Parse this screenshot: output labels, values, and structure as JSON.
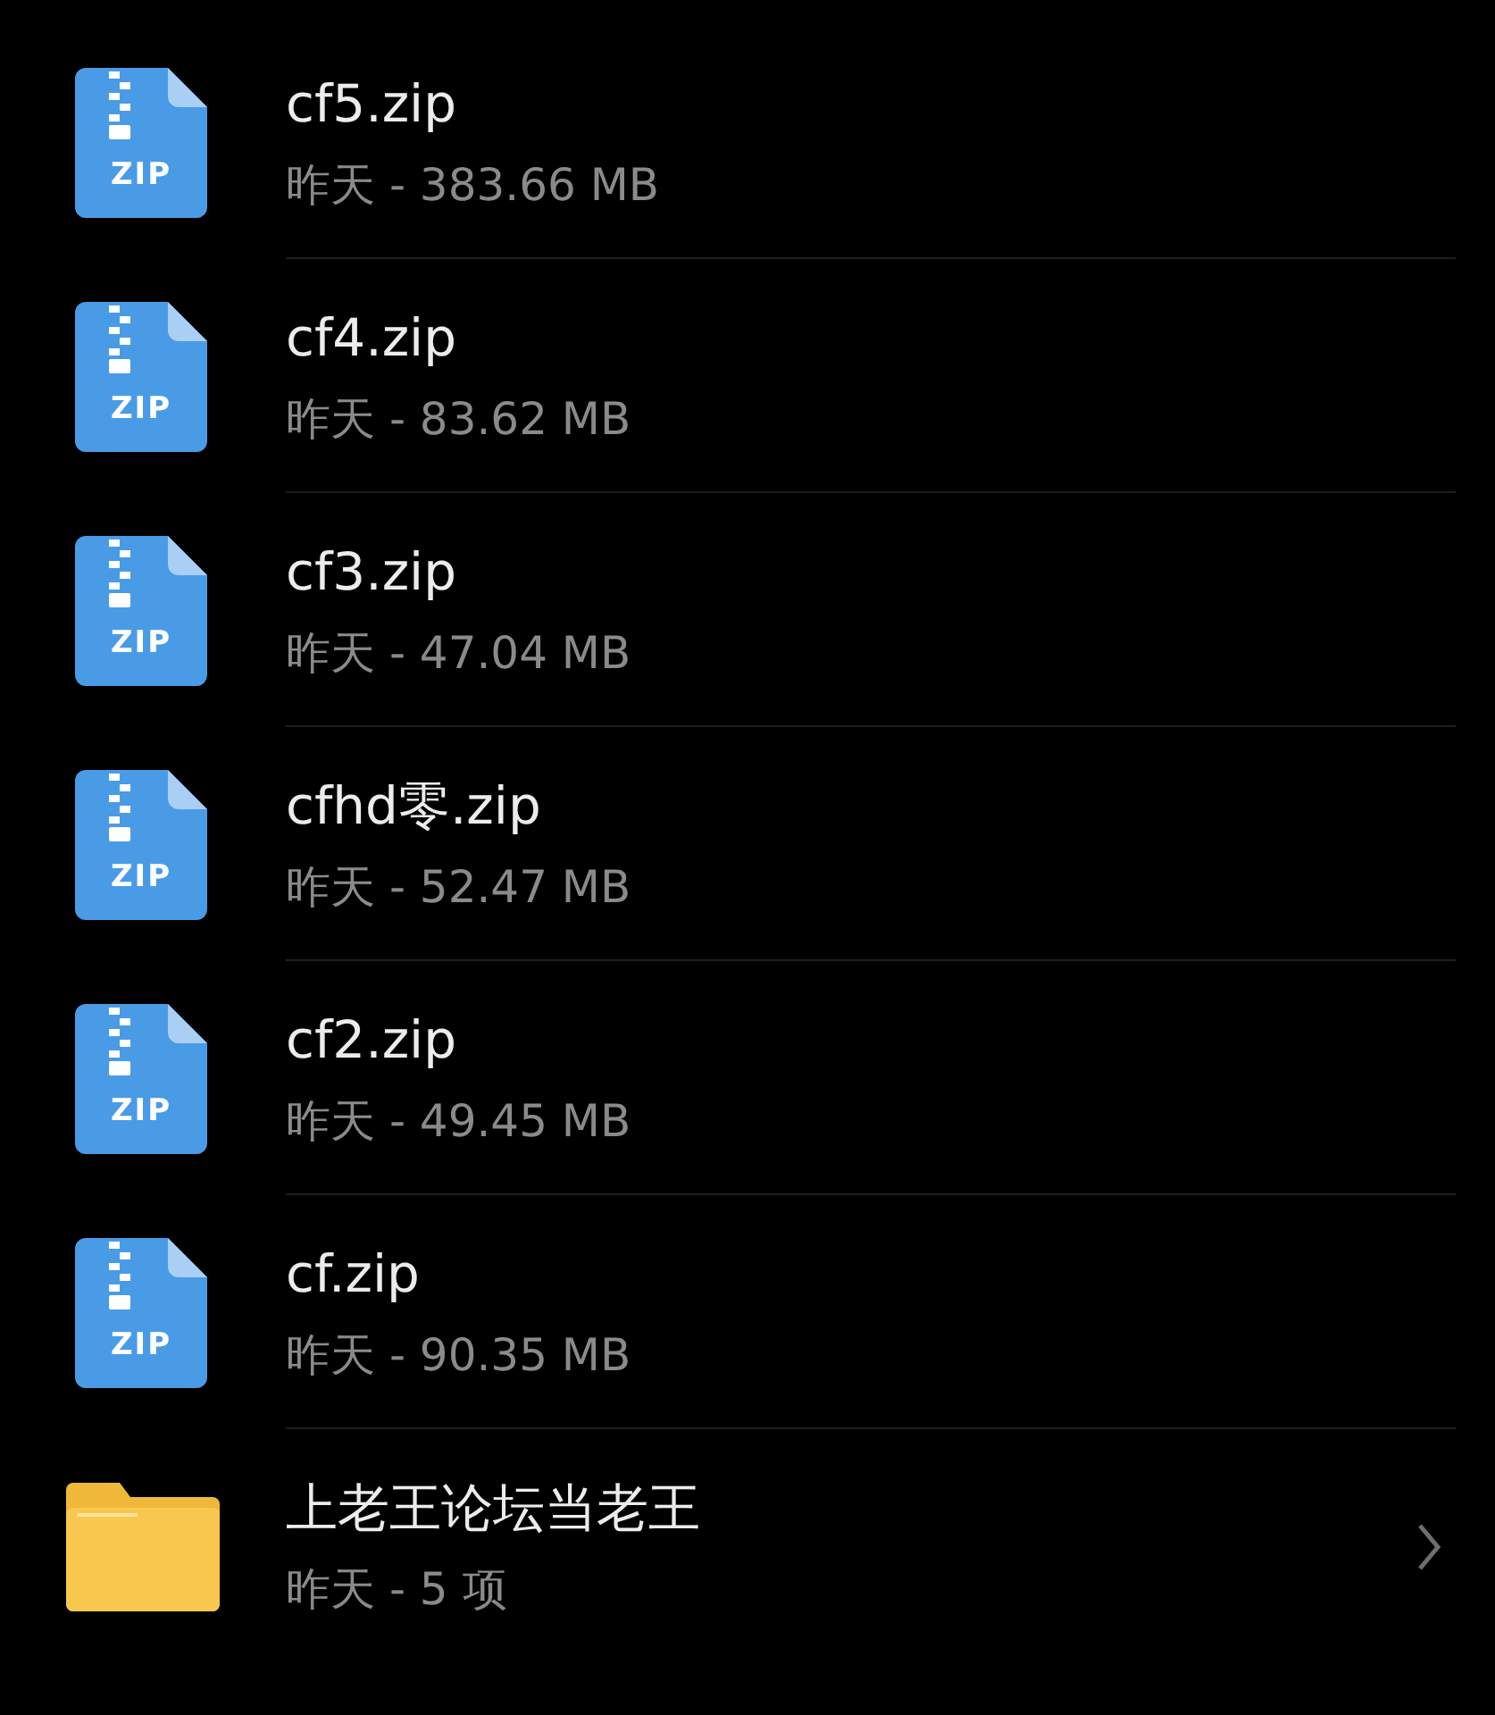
{
  "files": [
    {
      "kind": "zip",
      "icon_label": "ZIP",
      "name": "cf5.zip",
      "details": "昨天 - 383.66 MB"
    },
    {
      "kind": "zip",
      "icon_label": "ZIP",
      "name": "cf4.zip",
      "details": "昨天 - 83.62 MB"
    },
    {
      "kind": "zip",
      "icon_label": "ZIP",
      "name": "cf3.zip",
      "details": "昨天 - 47.04 MB"
    },
    {
      "kind": "zip",
      "icon_label": "ZIP",
      "name": "cfhd零.zip",
      "details": "昨天 - 52.47 MB"
    },
    {
      "kind": "zip",
      "icon_label": "ZIP",
      "name": "cf2.zip",
      "details": "昨天 - 49.45 MB"
    },
    {
      "kind": "zip",
      "icon_label": "ZIP",
      "name": "cf.zip",
      "details": "昨天 - 90.35 MB"
    },
    {
      "kind": "folder",
      "name": "上老王论坛当老王",
      "details": "昨天 - 5 项"
    }
  ]
}
